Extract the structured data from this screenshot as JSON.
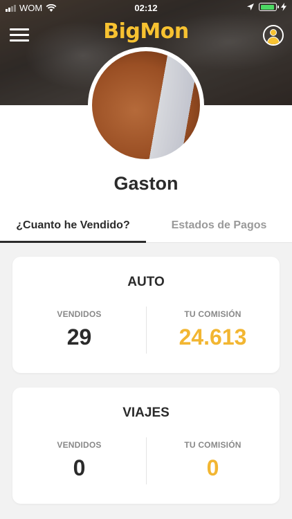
{
  "status_bar": {
    "carrier": "WOM",
    "time": "02:12"
  },
  "header": {
    "app_name": "BigMon"
  },
  "profile": {
    "name": "Gaston"
  },
  "tabs": [
    {
      "label": "¿Cuanto he Vendido?",
      "active": true
    },
    {
      "label": "Estados de Pagos",
      "active": false
    }
  ],
  "cards": [
    {
      "title": "AUTO",
      "sold_label": "VENDIDOS",
      "sold_value": "29",
      "commission_label": "TU COMISIÓN",
      "commission_value": "24.613"
    },
    {
      "title": "VIAJES",
      "sold_label": "VENDIDOS",
      "sold_value": "0",
      "commission_label": "TU COMISIÓN",
      "commission_value": "0"
    }
  ],
  "colors": {
    "accent": "#f2b632",
    "brand": "#f7c231",
    "text": "#2b2b2b"
  }
}
